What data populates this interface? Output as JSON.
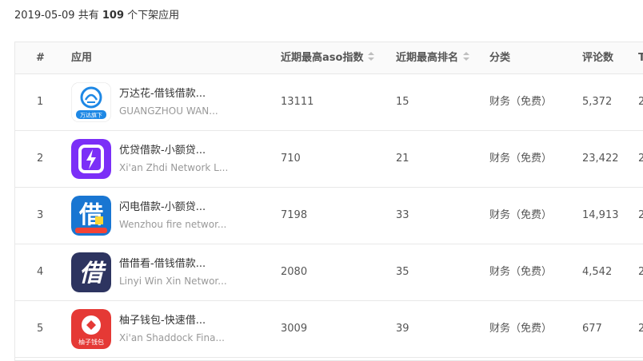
{
  "summary": {
    "date": "2019-05-09",
    "prefix": "共有",
    "count": "109",
    "suffix": "个下架应用"
  },
  "columns": {
    "index": "#",
    "app": "应用",
    "aso": "近期最高aso指数",
    "rank": "近期最高排名",
    "category": "分类",
    "reviews": "评论数",
    "next": "T"
  },
  "rows": [
    {
      "index": "1",
      "name": "万达花-借钱借款...",
      "developer": "GUANGZHOU WAN...",
      "aso": "13111",
      "rank": "15",
      "category": "财务（免费）",
      "reviews": "5,372",
      "next": "2",
      "icon": "wanda-logo-icon",
      "icon_text": "万达旗下",
      "icon_color": "#1e88e5"
    },
    {
      "index": "2",
      "name": "优贷借款-小额贷...",
      "developer": "Xi'an Zhdi Network L...",
      "aso": "710",
      "rank": "21",
      "category": "财务（免费）",
      "reviews": "23,422",
      "next": "2",
      "icon": "lightning-icon",
      "icon_text": "",
      "icon_color": "#7b2ff7"
    },
    {
      "index": "3",
      "name": "闪电借款-小额贷...",
      "developer": "Wenzhou fire networ...",
      "aso": "7198",
      "rank": "33",
      "category": "财务（免费）",
      "reviews": "14,913",
      "next": "2",
      "icon": "jie-char-icon",
      "icon_text": "借",
      "icon_color": "#1976d2"
    },
    {
      "index": "4",
      "name": "借借看-借钱借款...",
      "developer": "Linyi Win Xin Networ...",
      "aso": "2080",
      "rank": "35",
      "category": "财务（免费）",
      "reviews": "4,542",
      "next": "2",
      "icon": "jie-char-icon",
      "icon_text": "借",
      "icon_color": "#2d3460"
    },
    {
      "index": "5",
      "name": "柚子钱包-快速借...",
      "developer": "Xi'an Shaddock Fina...",
      "aso": "3009",
      "rank": "39",
      "category": "财务（免费）",
      "reviews": "677",
      "next": "2",
      "icon": "wallet-icon",
      "icon_text": "柚子钱包",
      "icon_color": "#e53935"
    }
  ]
}
